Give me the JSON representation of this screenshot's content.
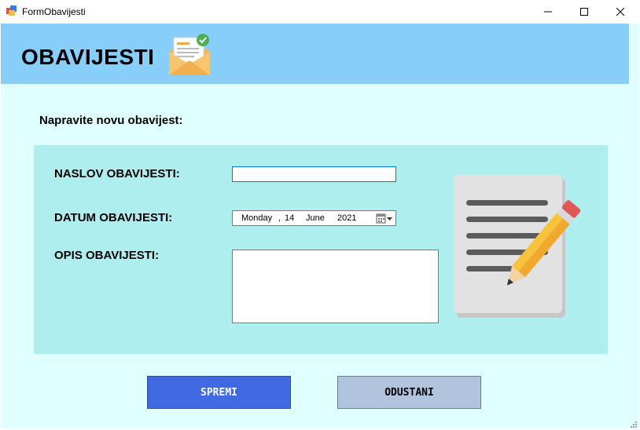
{
  "window": {
    "title": "FormObavijesti",
    "icon": "winforms-app-icon"
  },
  "header": {
    "title": "OBAVIJESTI",
    "icon": "envelope-check-icon"
  },
  "form": {
    "subtitle": "Napravite novu obavijest:",
    "title_label": "NASLOV OBAVIJESTI:",
    "title_value": "",
    "date_label": "DATUM OBAVIJESTI:",
    "date": {
      "weekday": "Monday",
      "separator": ",",
      "day": "14",
      "month": "June",
      "year": "2021"
    },
    "description_label": "OPIS OBAVIJESTI:",
    "description_value": "",
    "illustration": "notepad-pencil-icon"
  },
  "actions": {
    "save_label": "SPREMI",
    "cancel_label": "ODUSTANI"
  },
  "colors": {
    "header_band": "#87cefa",
    "background": "#e0ffff",
    "panel": "#afeeee",
    "save_button": "#4169e1",
    "cancel_button": "#b0c4de"
  }
}
